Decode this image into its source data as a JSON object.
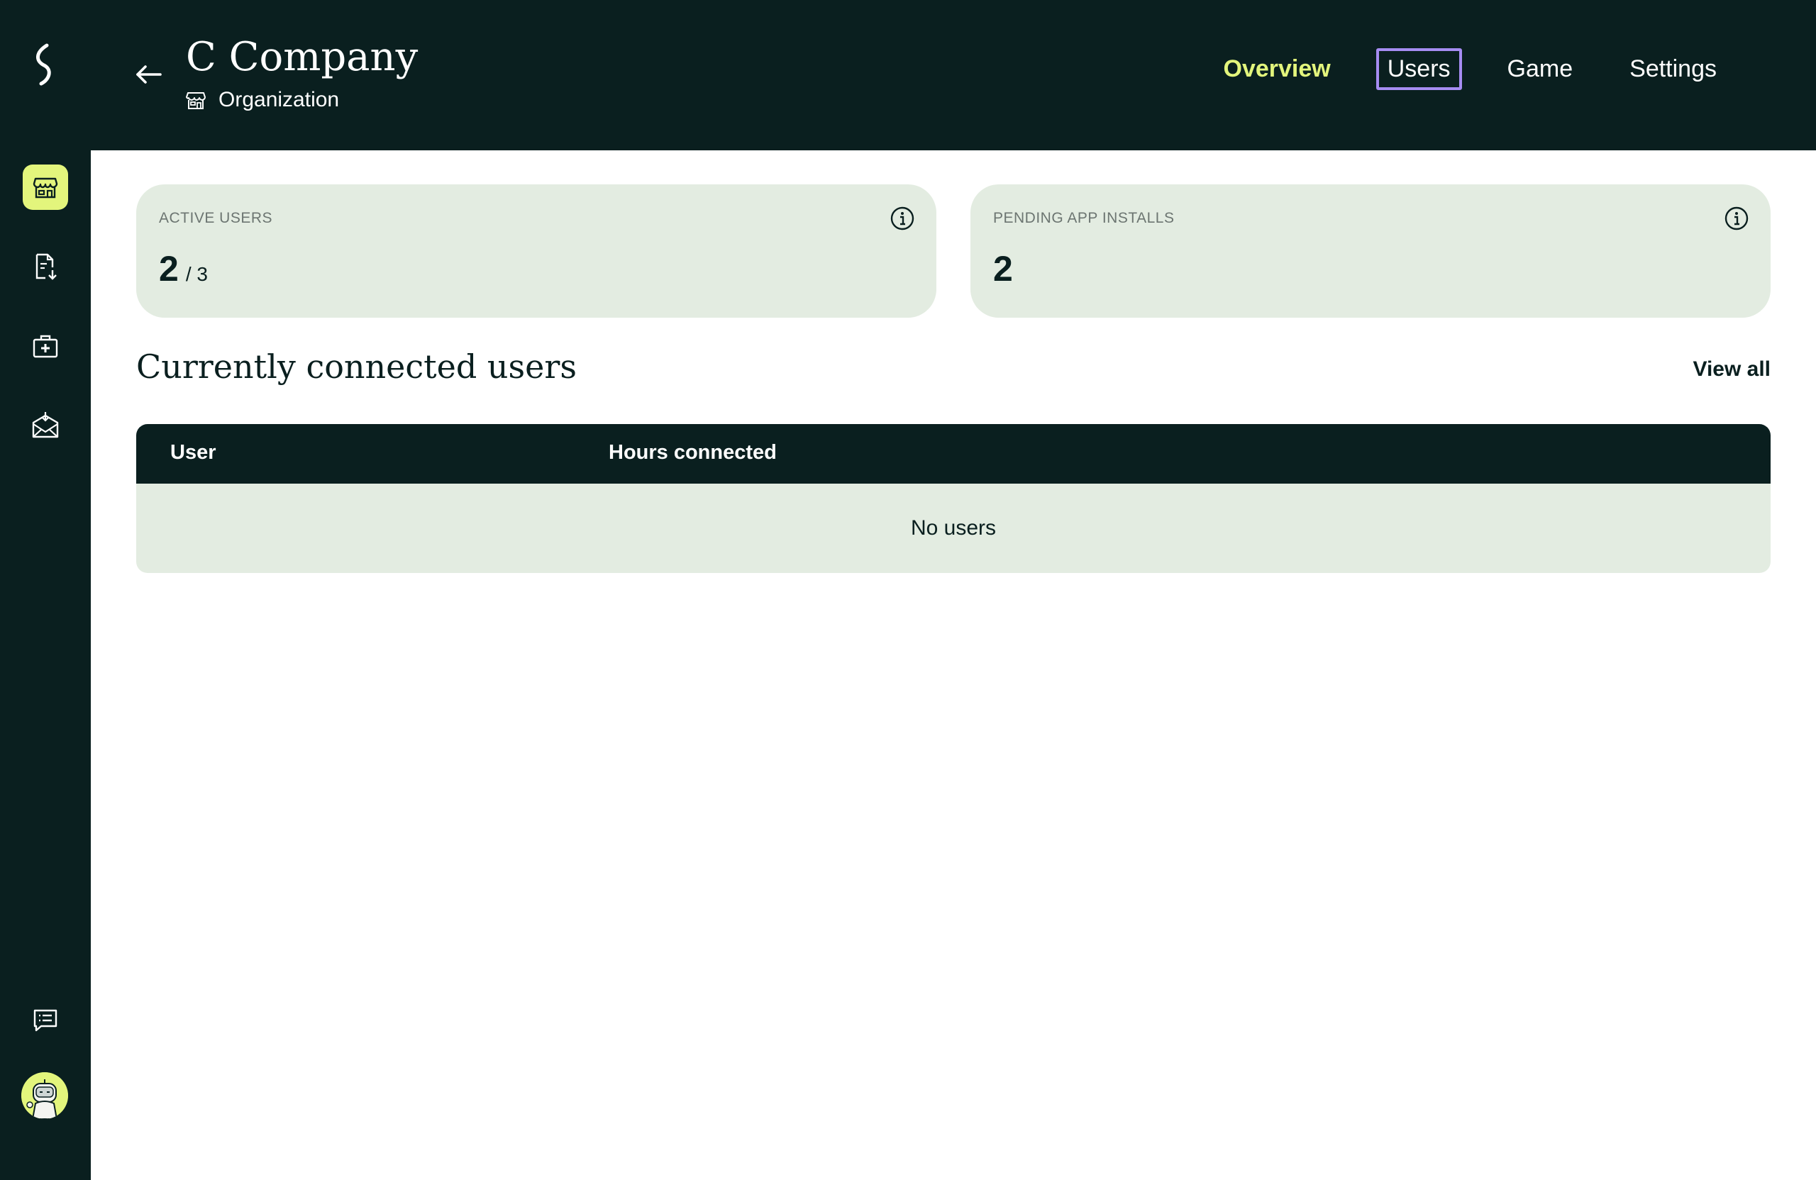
{
  "header": {
    "company_name": "C Company",
    "organization_label": "Organization",
    "tabs": [
      {
        "label": "Overview",
        "state": "active"
      },
      {
        "label": "Users",
        "state": "focused"
      },
      {
        "label": "Game",
        "state": "default"
      },
      {
        "label": "Settings",
        "state": "default"
      }
    ]
  },
  "sidebar": {
    "items": [
      {
        "icon": "storefront-icon",
        "active": true
      },
      {
        "icon": "document-download-icon",
        "active": false
      },
      {
        "icon": "medical-kit-icon",
        "active": false
      },
      {
        "icon": "mail-inbox-icon",
        "active": false
      }
    ],
    "bottom": [
      {
        "icon": "chat-message-icon"
      },
      {
        "icon": "avatar"
      }
    ]
  },
  "stats": {
    "active_users": {
      "label": "ACTIVE USERS",
      "value": "2",
      "total": "/ 3"
    },
    "pending_installs": {
      "label": "PENDING APP INSTALLS",
      "value": "2"
    }
  },
  "connected_users": {
    "title": "Currently connected users",
    "view_all": "View all",
    "columns": [
      "User",
      "Hours connected"
    ],
    "rows": [],
    "empty_text": "No users"
  },
  "colors": {
    "dark": "#0a1f1f",
    "accent": "#e3f57c",
    "card_bg": "#e3ece1",
    "focus_ring": "#a68cf2"
  }
}
